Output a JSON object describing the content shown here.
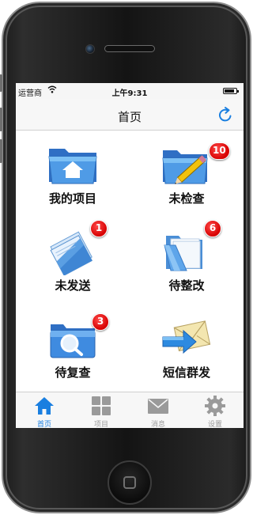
{
  "status_bar": {
    "carrier": "运营商",
    "time": "上午9:31"
  },
  "nav": {
    "title": "首页"
  },
  "grid": {
    "items": [
      {
        "label": "我的项目",
        "icon": "folder-home-icon",
        "badge": ""
      },
      {
        "label": "未检查",
        "icon": "folder-pencil-icon",
        "badge": "10"
      },
      {
        "label": "未发送",
        "icon": "documents-icon",
        "badge": "1"
      },
      {
        "label": "待整改",
        "icon": "open-folder-icon",
        "badge": "6"
      },
      {
        "label": "待复查",
        "icon": "folder-search-icon",
        "badge": "3"
      },
      {
        "label": "短信群发",
        "icon": "envelope-arrow-icon",
        "badge": ""
      }
    ]
  },
  "tabbar": {
    "items": [
      {
        "label": "首页",
        "icon": "home-icon",
        "active": true
      },
      {
        "label": "项目",
        "icon": "grid-icon",
        "active": false
      },
      {
        "label": "消息",
        "icon": "mail-icon",
        "active": false
      },
      {
        "label": "设置",
        "icon": "gear-icon",
        "active": false
      }
    ]
  },
  "colors": {
    "accent": "#1a7fe0",
    "badge": "#d60000",
    "tab_inactive": "#9a9a9a"
  }
}
